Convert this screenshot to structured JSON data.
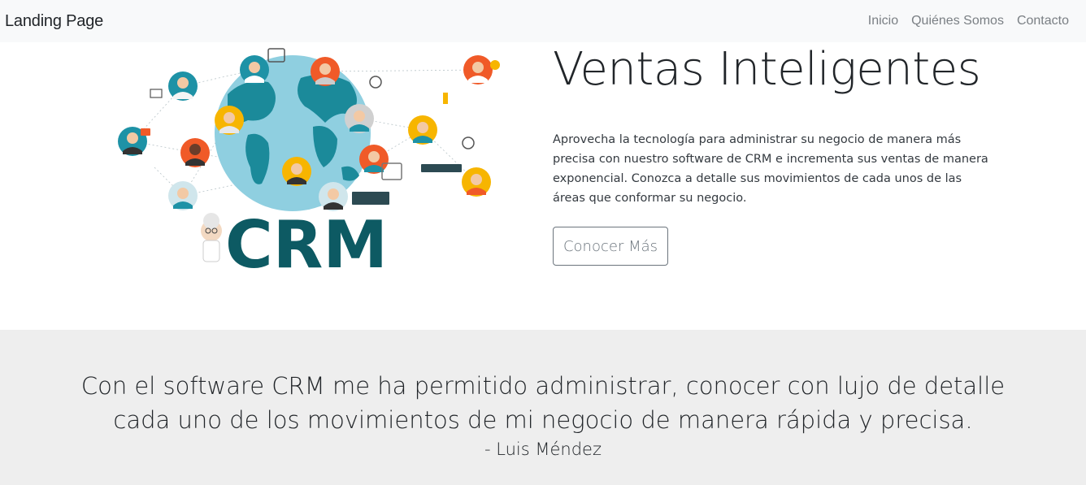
{
  "navbar": {
    "brand": "Landing Page",
    "links": [
      "Inicio",
      "Quiénes Somos",
      "Contacto"
    ]
  },
  "hero": {
    "title": "Ventas Inteligentes",
    "description": "Aprovecha la tecnología para administrar su negocio de manera más precisa con nuestro software de CRM e incrementa sus ventas de manera exponencial. Conozca a detalle sus movimientos de cada unos de las áreas que conformar su negocio.",
    "button_label": "Conocer Más",
    "image_logo_text": "CRM"
  },
  "testimonial": {
    "quote": "Con el software CRM me ha permitido administrar, conocer con lujo de detalle cada uno de los movimientos de mi negocio de manera rápida y precisa.",
    "author": "- Luis Méndez"
  },
  "colors": {
    "navbar_bg": "#f8f9fa",
    "testimonial_bg": "#eeeeee",
    "crm_text": "#0d5a63",
    "globe_ocean": "#7fc7d9",
    "globe_land": "#1b8a9a"
  }
}
